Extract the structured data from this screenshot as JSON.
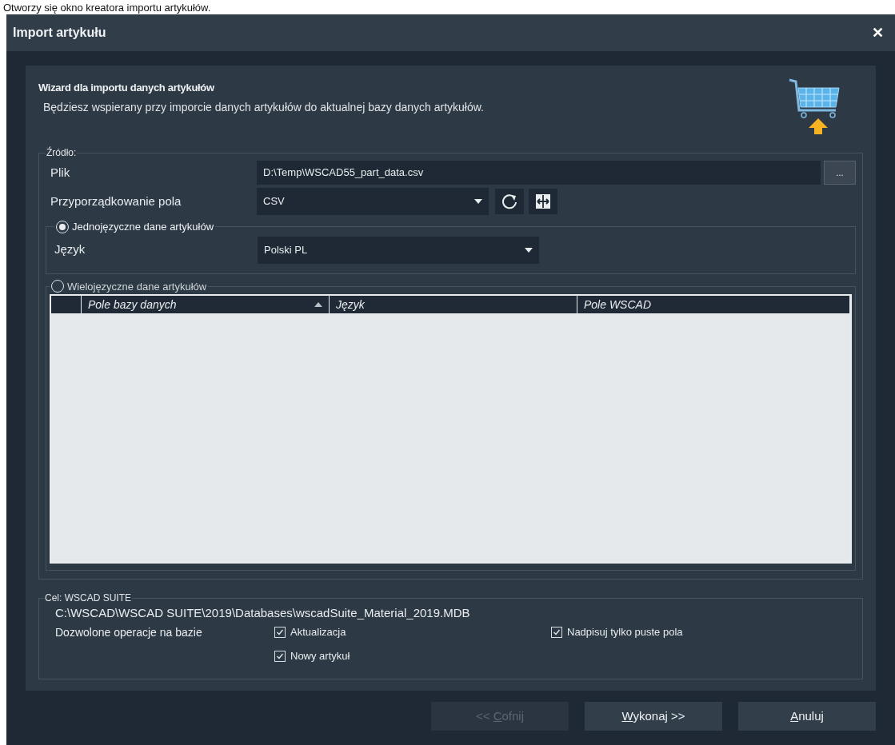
{
  "caption": "Otworzy się okno kreatora importu artykułów.",
  "window": {
    "title": "Import artykułu",
    "close": "✕"
  },
  "header": {
    "title": "Wizard dla importu danych artykułów",
    "description": "Będziesz wspierany przy imporcie danych artykułów do aktualnej bazy danych artykułów."
  },
  "source": {
    "legend": "Źródło:",
    "file": {
      "label": "Plik",
      "value": "D:\\Temp\\WSCAD55_part_data.csv",
      "browse": "..."
    },
    "mapping": {
      "label": "Przyporządkowanie pola",
      "value": "CSV"
    },
    "modes": [
      {
        "label": "Jednojęzyczne dane artykułów",
        "selected": true,
        "kind": "single",
        "language_label": "Język",
        "language_value": "Polski PL"
      },
      {
        "label": "Wielojęzyczne dane artykułów",
        "selected": false,
        "kind": "table",
        "columns": [
          {
            "label": "Pole bazy danych",
            "sorted": true
          },
          {
            "label": "Język",
            "sorted": false
          },
          {
            "label": "Pole WSCAD",
            "sorted": false
          }
        ]
      }
    ]
  },
  "target": {
    "legend": "Cel: WSCAD SUITE",
    "path": "C:\\WSCAD\\WSCAD SUITE\\2019\\Databases\\wscadSuite_Material_2019.MDB",
    "operations_label": "Dozwolone operacje na bazie",
    "options": [
      {
        "label": "Aktualizacja",
        "checked": true
      },
      {
        "label": "Nadpisuj tylko puste pola",
        "checked": true
      },
      {
        "label": "Nowy artykuł",
        "checked": true
      }
    ]
  },
  "buttons": [
    {
      "parts": [
        {
          "text": "<< ",
          "underline": false
        },
        {
          "text": "C",
          "underline": true
        },
        {
          "text": "ofnij",
          "underline": false
        }
      ],
      "disabled": true
    },
    {
      "parts": [
        {
          "text": "W",
          "underline": true
        },
        {
          "text": "ykonaj >>",
          "underline": false
        }
      ],
      "disabled": false
    },
    {
      "parts": [
        {
          "text": "A",
          "underline": true
        },
        {
          "text": "nuluj",
          "underline": false
        }
      ],
      "disabled": false
    }
  ]
}
